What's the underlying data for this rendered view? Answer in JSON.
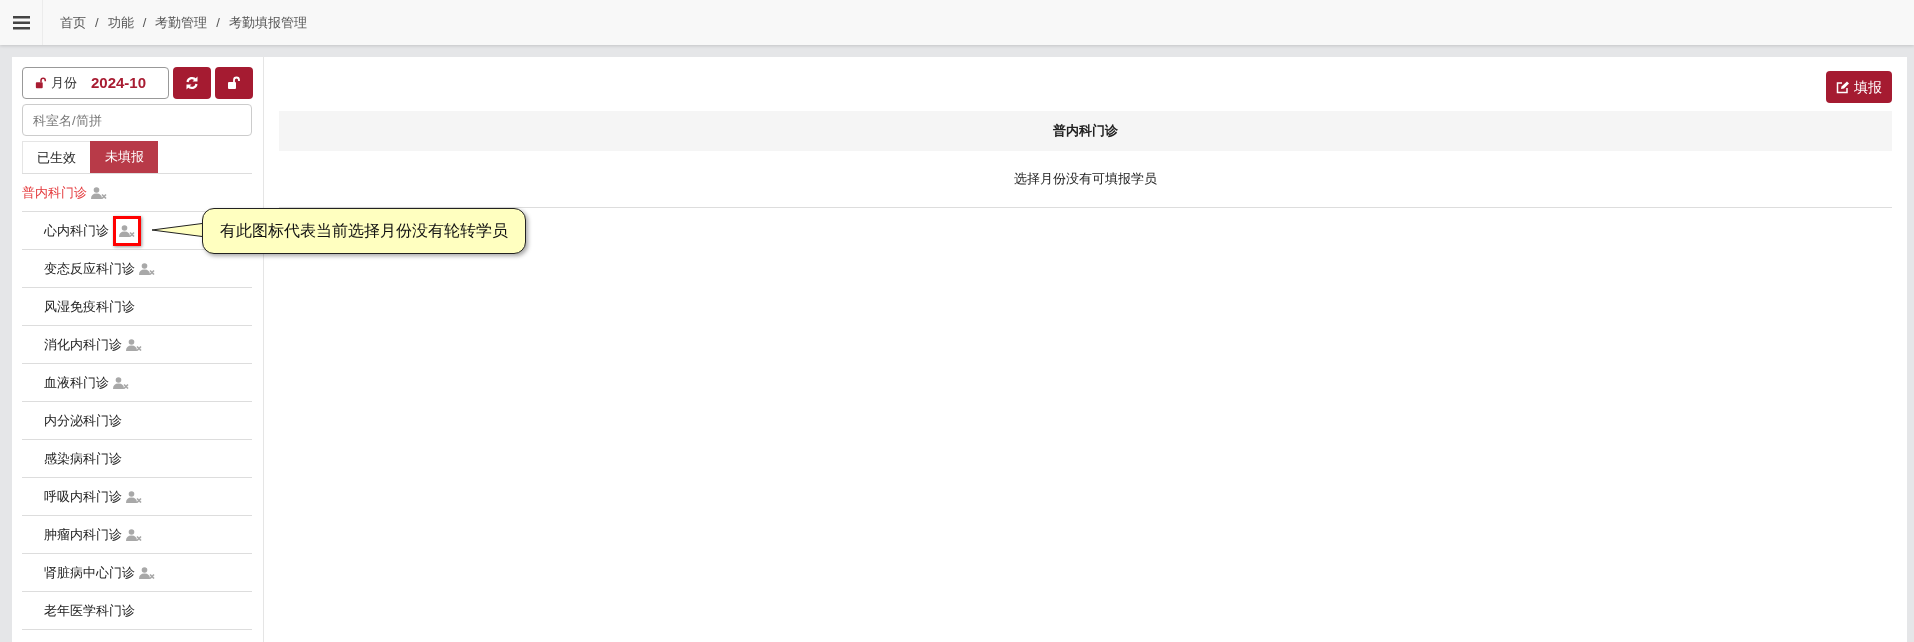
{
  "breadcrumb": [
    "首页",
    "功能",
    "考勤管理",
    "考勤填报管理"
  ],
  "breadcrumb_separator": "/",
  "month": {
    "label": "月份",
    "value": "2024-10"
  },
  "search": {
    "placeholder": "科室名/简拼"
  },
  "tabs": [
    {
      "label": "已生效",
      "selected": false
    },
    {
      "label": "未填报",
      "selected": true
    }
  ],
  "departments": [
    {
      "name": "普内科门诊",
      "selected": true,
      "no_trainees": true,
      "highlighted": false
    },
    {
      "name": "心内科门诊",
      "selected": false,
      "no_trainees": true,
      "highlighted": true
    },
    {
      "name": "变态反应科门诊",
      "selected": false,
      "no_trainees": true,
      "highlighted": false
    },
    {
      "name": "风湿免疫科门诊",
      "selected": false,
      "no_trainees": false,
      "highlighted": false
    },
    {
      "name": "消化内科门诊",
      "selected": false,
      "no_trainees": true,
      "highlighted": false
    },
    {
      "name": "血液科门诊",
      "selected": false,
      "no_trainees": true,
      "highlighted": false
    },
    {
      "name": "内分泌科门诊",
      "selected": false,
      "no_trainees": false,
      "highlighted": false
    },
    {
      "name": "感染病科门诊",
      "selected": false,
      "no_trainees": false,
      "highlighted": false
    },
    {
      "name": "呼吸内科门诊",
      "selected": false,
      "no_trainees": true,
      "highlighted": false
    },
    {
      "name": "肿瘤内科门诊",
      "selected": false,
      "no_trainees": true,
      "highlighted": false
    },
    {
      "name": "肾脏病中心门诊",
      "selected": false,
      "no_trainees": true,
      "highlighted": false
    },
    {
      "name": "老年医学科门诊",
      "selected": false,
      "no_trainees": false,
      "highlighted": false
    }
  ],
  "callout": {
    "text": "有此图标代表当前选择月份没有轮转学员"
  },
  "fill_button": {
    "label": "填报"
  },
  "table": {
    "header": "普内科门诊",
    "empty_message": "选择月份没有可填报学员"
  }
}
